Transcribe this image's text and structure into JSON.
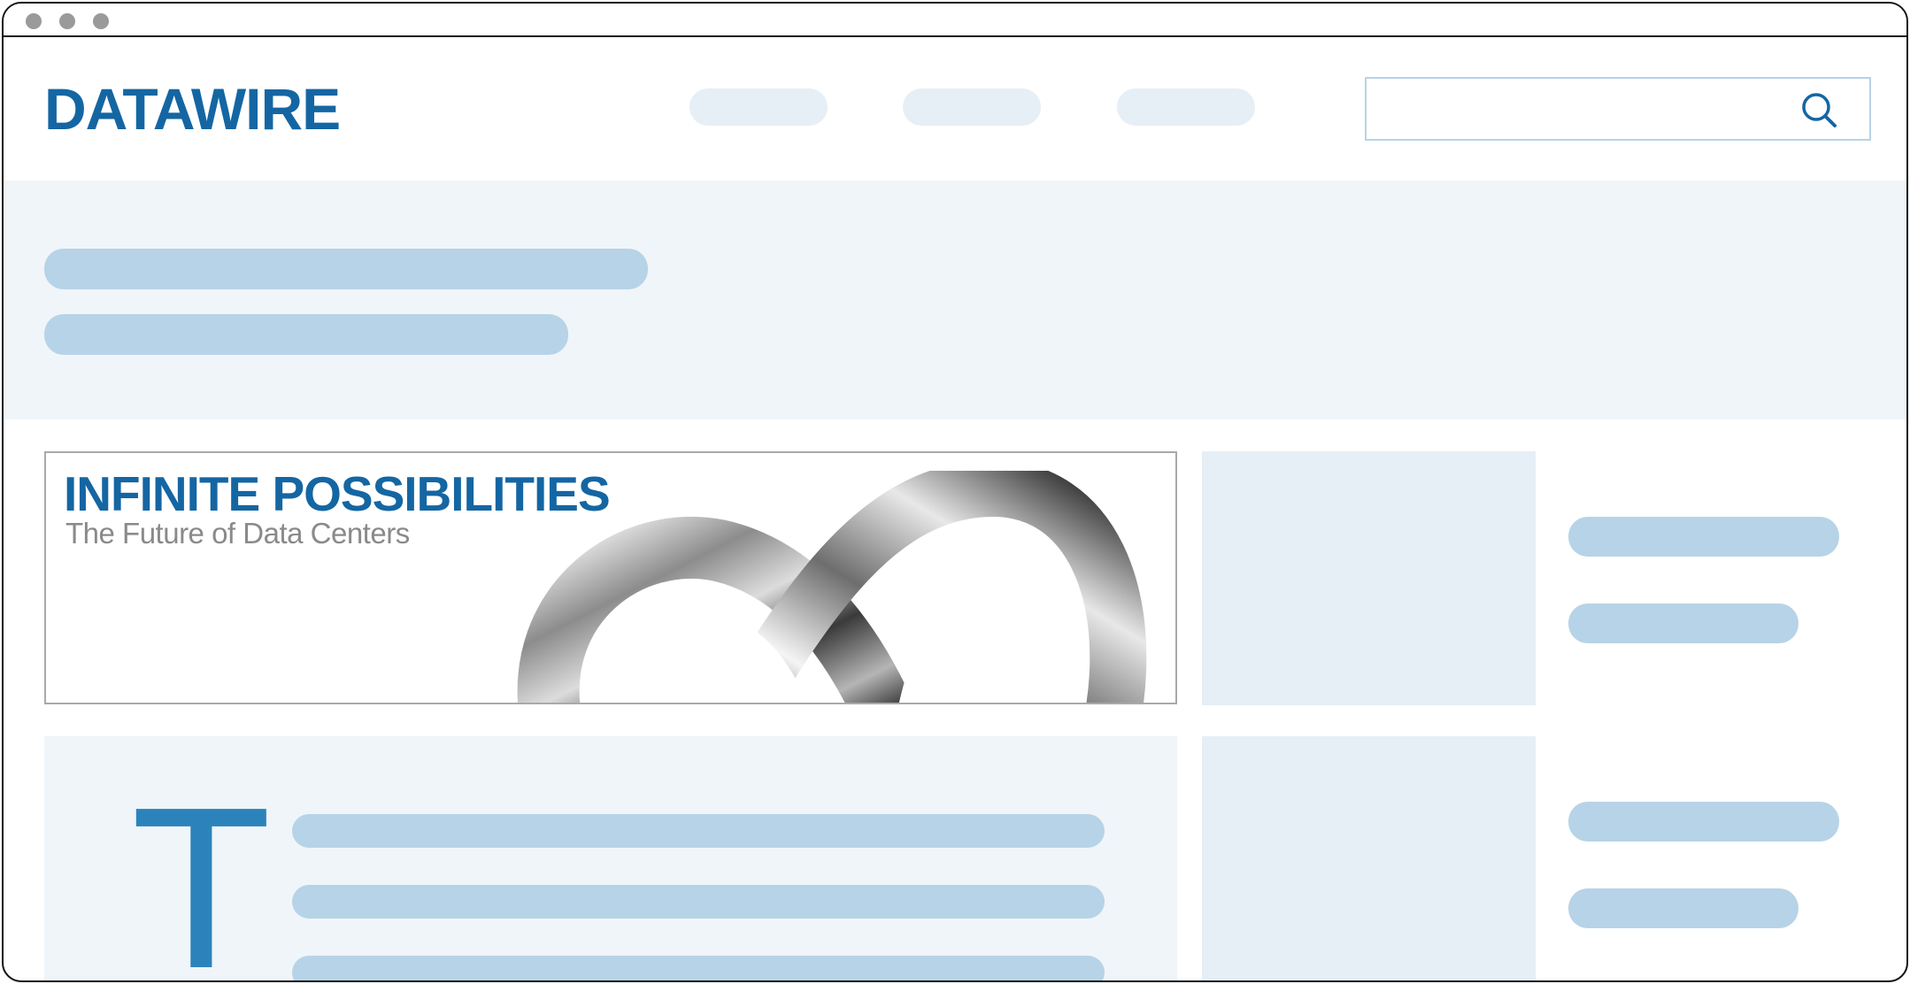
{
  "header": {
    "logo_text": "DATAWIRE",
    "search": {
      "placeholder": "",
      "value": ""
    },
    "icons": {
      "search": "search-icon"
    }
  },
  "banner": {
    "title": "INFINITE POSSIBILITIES",
    "subtitle": "The Future of Data Centers",
    "image": "infinity-symbol"
  },
  "article": {
    "dropcap": "T"
  },
  "colors": {
    "brand_blue": "#1466a3",
    "dropcap_blue": "#2c83bb",
    "placeholder_bar": "#b7d3e7",
    "panel_light": "#f0f5f9",
    "panel_box": "#e6eef6"
  }
}
